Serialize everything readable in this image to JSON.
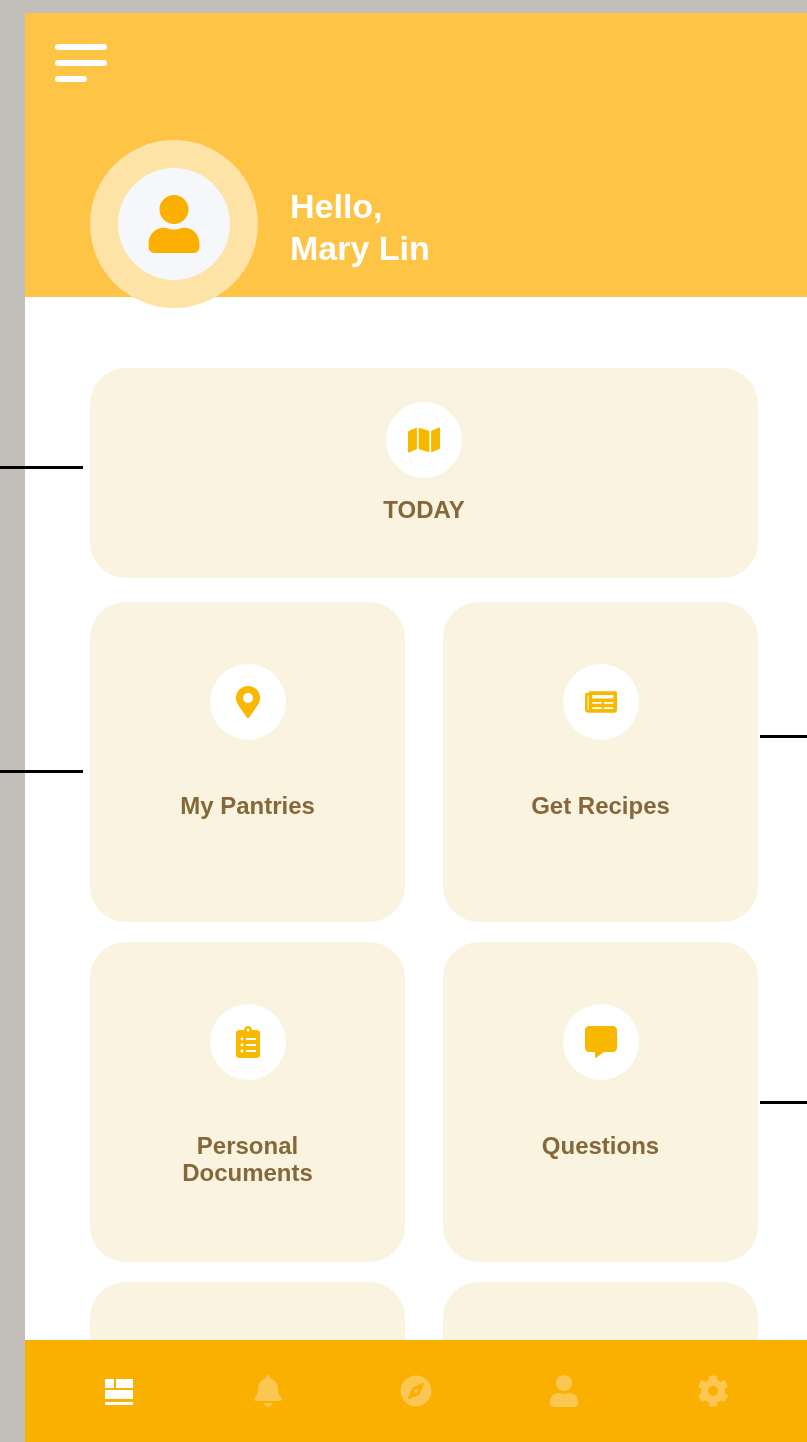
{
  "header": {
    "greeting": "Hello,",
    "name": "Mary Lin"
  },
  "featured": {
    "label": "TODAY"
  },
  "tiles": [
    {
      "kind": "labeled",
      "label": "My Pantries"
    },
    {
      "kind": "labeled",
      "label": "Get Recipes"
    },
    {
      "kind": "labeled",
      "label": "Personal Documents"
    },
    {
      "kind": "labeled",
      "label": "Questions"
    },
    {
      "kind": "partial"
    },
    {
      "kind": "partial"
    }
  ],
  "bottom_nav": [
    {
      "selected": true
    },
    {
      "selected": false
    },
    {
      "selected": false
    },
    {
      "selected": false
    },
    {
      "selected": false
    }
  ]
}
